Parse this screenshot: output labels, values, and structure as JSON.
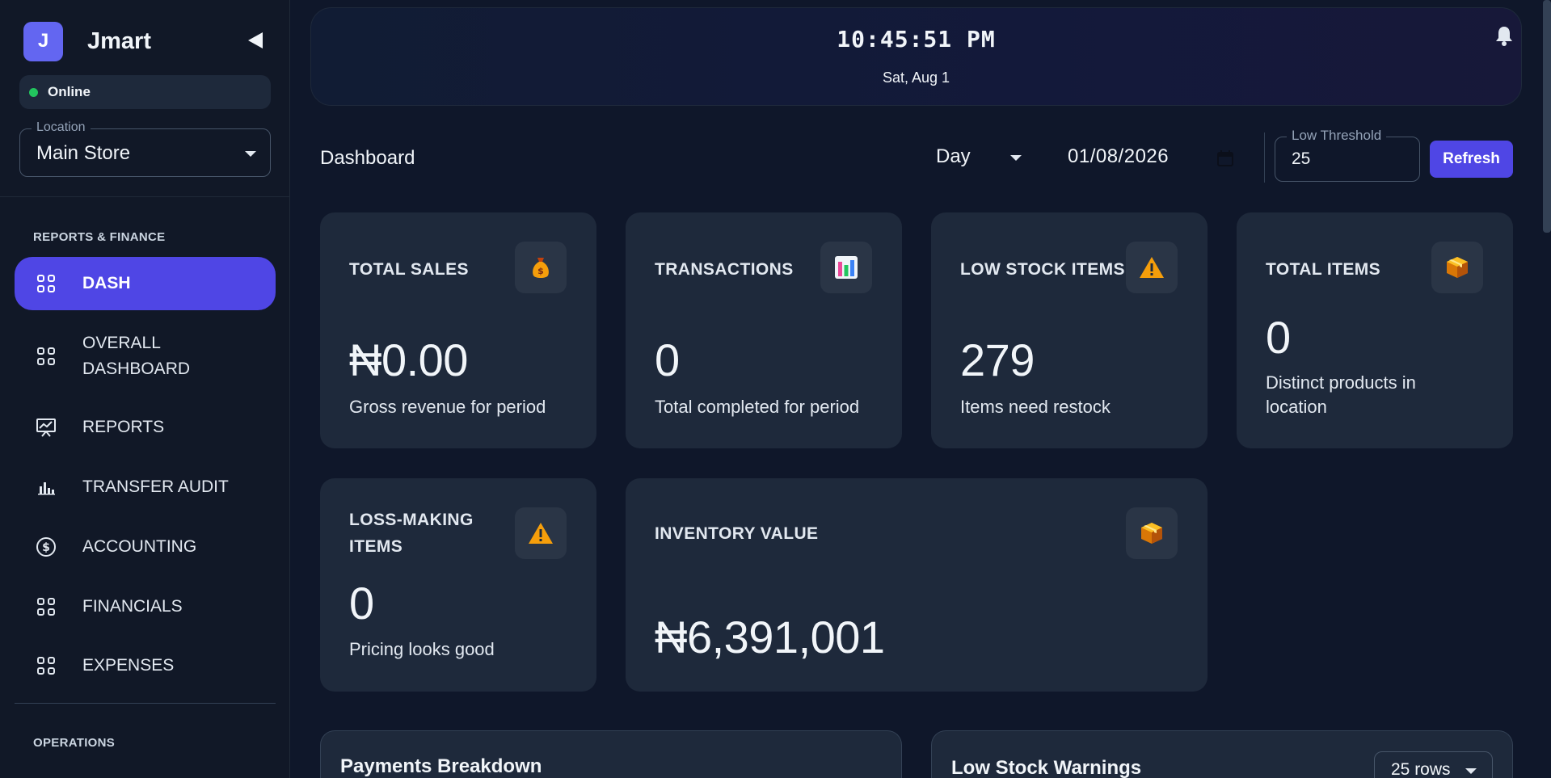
{
  "brand": {
    "initial": "J",
    "name": "Jmart"
  },
  "status": {
    "label": "Online",
    "color": "#22c55e"
  },
  "location": {
    "label": "Location",
    "value": "Main Store"
  },
  "sidebar": {
    "sections": [
      {
        "title": "REPORTS & FINANCE"
      },
      {
        "title": "OPERATIONS"
      }
    ],
    "items": [
      {
        "label": "DASH",
        "icon": "grid-icon",
        "active": true
      },
      {
        "label": "OVERALL DASHBOARD",
        "line1": "OVERALL",
        "line2": "DASHBOARD",
        "icon": "grid-icon"
      },
      {
        "label": "REPORTS",
        "icon": "presentation-chart-icon"
      },
      {
        "label": "TRANSFER AUDIT",
        "icon": "bar-chart-icon"
      },
      {
        "label": "ACCOUNTING",
        "icon": "dollar-circle-icon"
      },
      {
        "label": "FINANCIALS",
        "icon": "grid-icon"
      },
      {
        "label": "EXPENSES",
        "icon": "grid-icon"
      }
    ]
  },
  "header": {
    "time": "10:45:51 PM",
    "date": "Sat, Aug 1"
  },
  "toolbar": {
    "title": "Dashboard",
    "period": "Day",
    "date": "01/08/2026",
    "threshold_label": "Low Threshold",
    "threshold_value": "25",
    "refresh_label": "Refresh"
  },
  "cards": {
    "total_sales": {
      "title": "TOTAL SALES",
      "value": "₦0.00",
      "sub": "Gross revenue for period",
      "icon": "money-bag-icon"
    },
    "transactions": {
      "title": "TRANSACTIONS",
      "value": "0",
      "sub": "Total completed for period",
      "icon": "bar-chart-icon"
    },
    "low_stock": {
      "title": "LOW STOCK ITEMS",
      "value": "279",
      "sub": "Items need restock",
      "icon": "warning-icon"
    },
    "total_items": {
      "title": "TOTAL ITEMS",
      "value": "0",
      "sub_line1": "Distinct products in",
      "sub_line2": "location",
      "icon": "package-icon"
    },
    "loss_making": {
      "title_line1": "LOSS-MAKING",
      "title_line2": "ITEMS",
      "value": "0",
      "sub": "Pricing looks good",
      "icon": "warning-icon"
    },
    "inventory_value": {
      "title": "INVENTORY VALUE",
      "value": "₦6,391,001",
      "icon": "package-icon"
    }
  },
  "panels": {
    "payments": {
      "title": "Payments Breakdown"
    },
    "low_stock_warnings": {
      "title": "Low Stock Warnings",
      "rows_label": "25 rows"
    }
  },
  "colors": {
    "accent": "#4f46e5",
    "background": "#0f172a",
    "card": "#1e293b"
  }
}
